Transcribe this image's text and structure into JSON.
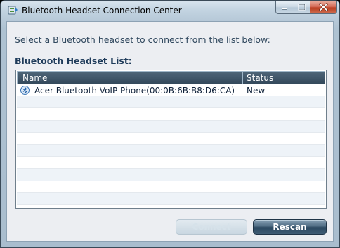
{
  "window": {
    "title": "Bluetooth Headset Connection Center",
    "icon": "bluetooth-headset-app-icon"
  },
  "controls": {
    "minimize": "minimize-icon",
    "maximize": "maximize-icon",
    "close": "close-icon"
  },
  "instruction": "Select a Bluetooth headset to connect from the list below:",
  "list": {
    "label": "Bluetooth Headset List:",
    "columns": {
      "name": "Name",
      "status": "Status"
    },
    "rows": [
      {
        "name": "Acer Bluetooth VoIP Phone(00:0B:6B:B8:D6:CA)",
        "status": "New",
        "icon": "bluetooth-device-icon"
      }
    ]
  },
  "buttons": {
    "connect": {
      "label": "Connect",
      "enabled": false
    },
    "rescan": {
      "label": "Rescan",
      "enabled": true
    }
  },
  "colors": {
    "header_bg": "#3f566a",
    "accent_text": "#1e3b5a",
    "close_red": "#c84a30"
  }
}
